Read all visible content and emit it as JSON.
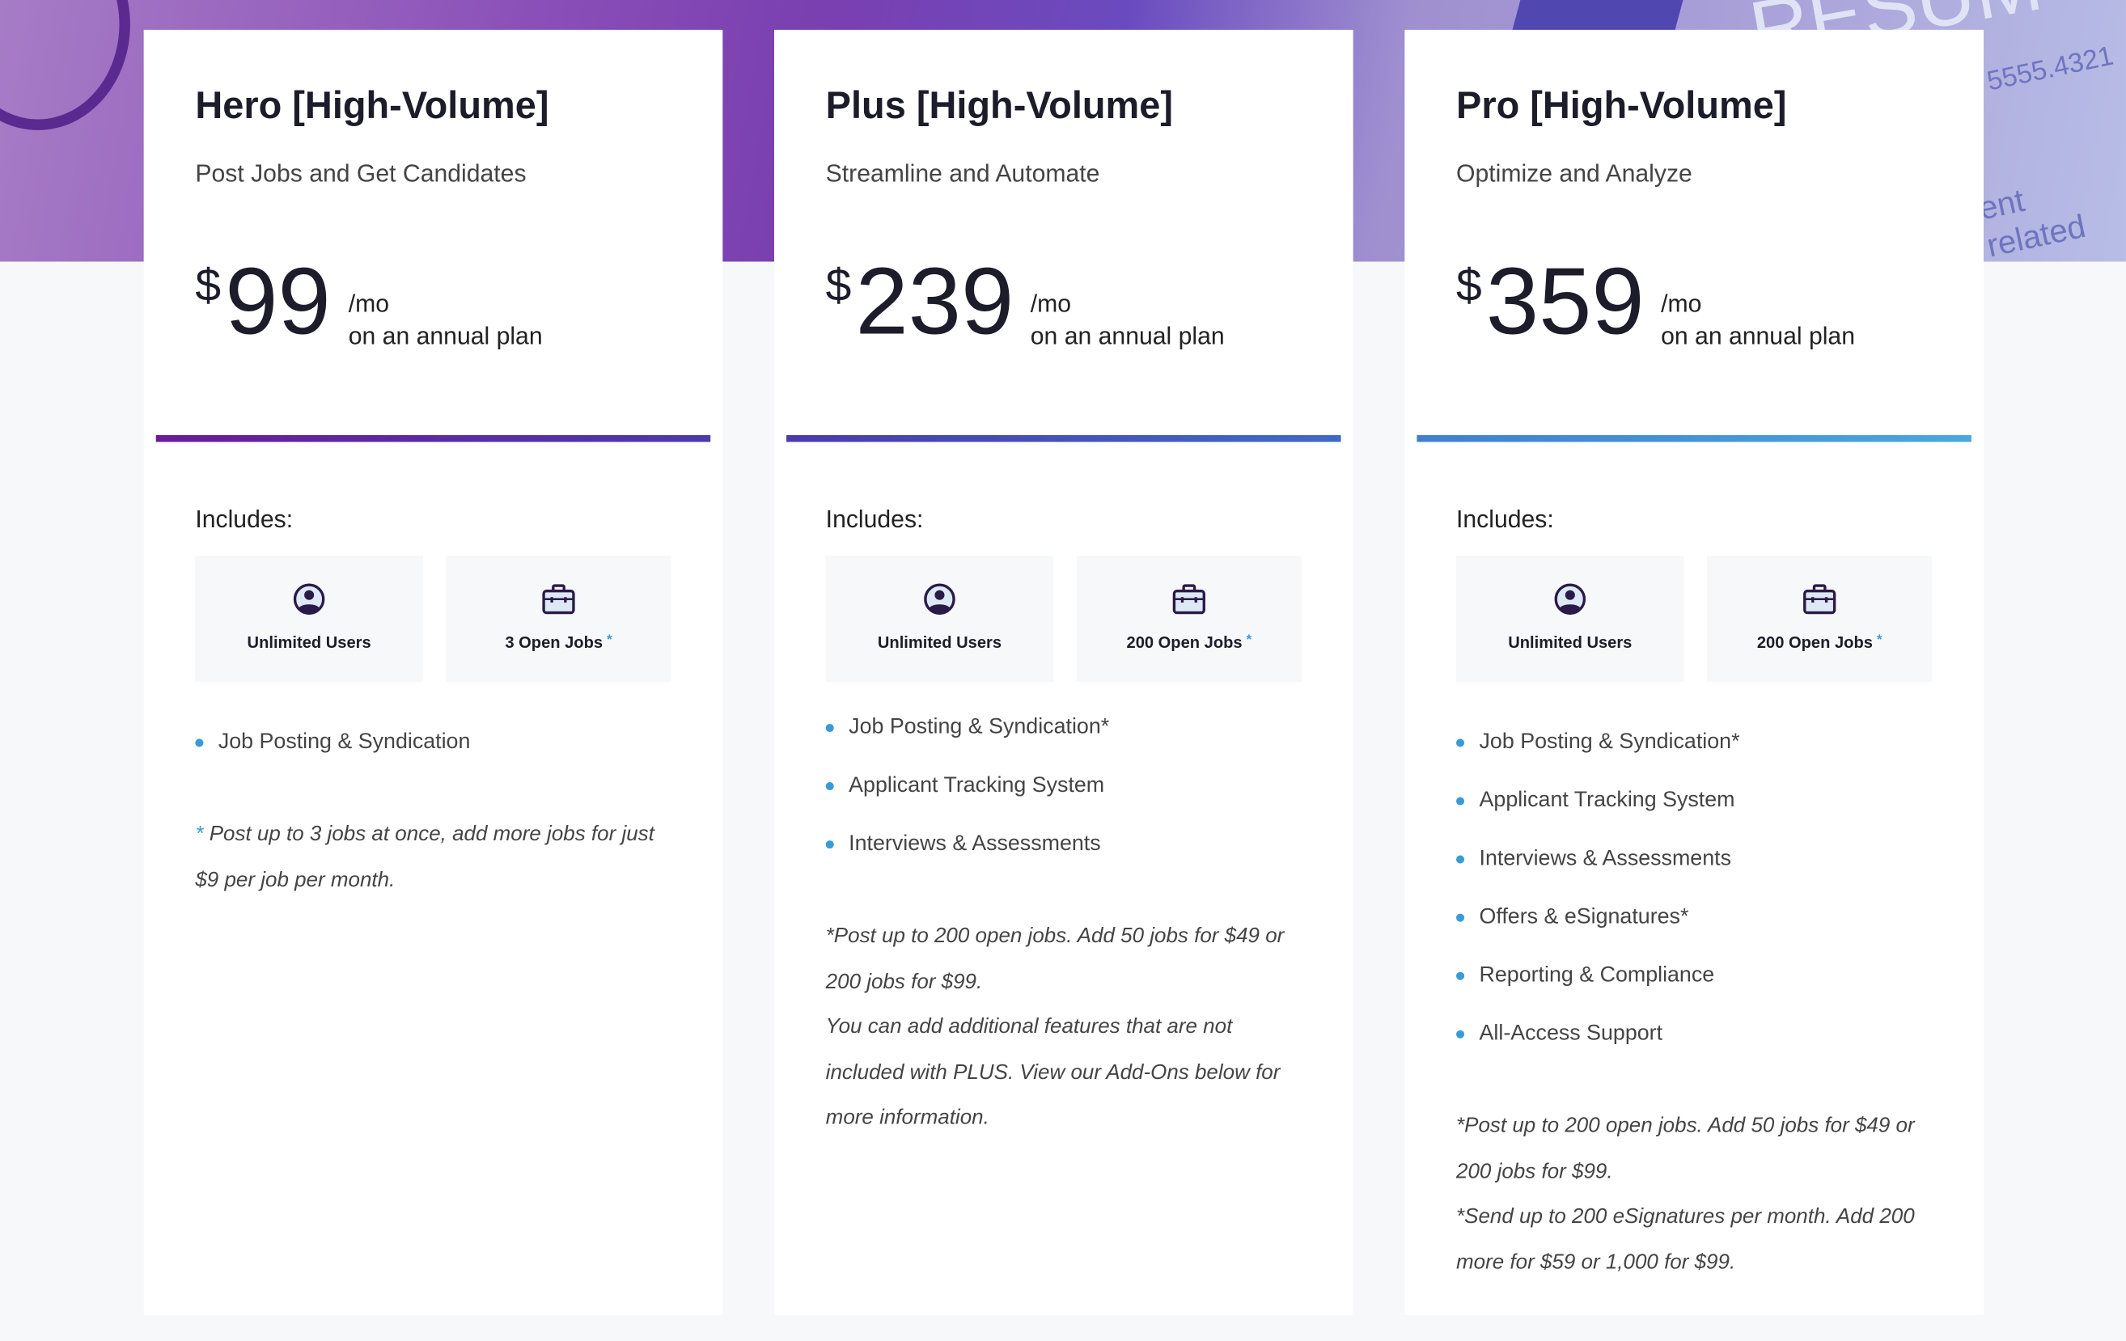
{
  "background_text": [
    "5555.4321",
    "ent related",
    "RESUM"
  ],
  "plans": [
    {
      "title": "Hero [High-Volume]",
      "subtitle": "Post Jobs and Get Candidates",
      "currency": "$",
      "price": "99",
      "per": "/mo",
      "term": "on an annual plan",
      "bar_colors": [
        "#6a1b9a",
        "#4a3aab"
      ],
      "includes": "Includes:",
      "boxes": [
        {
          "icon": "user-circle-icon",
          "label": "Unlimited Users",
          "asterisk": ""
        },
        {
          "icon": "briefcase-icon",
          "label": "3 Open Jobs",
          "asterisk": "*"
        }
      ],
      "features": [
        "Job Posting & Syndication"
      ],
      "notes": [
        {
          "asterisk": "*",
          "text": " Post up to 3 jobs at once, add more jobs for just $9 per job per month."
        }
      ]
    },
    {
      "title": "Plus [High-Volume]",
      "subtitle": "Streamline and Automate",
      "currency": "$",
      "price": "239",
      "per": "/mo",
      "term": "on an annual plan",
      "bar_colors": [
        "#4a3aab",
        "#3f6bc4"
      ],
      "includes": "Includes:",
      "boxes": [
        {
          "icon": "user-circle-icon",
          "label": "Unlimited Users",
          "asterisk": ""
        },
        {
          "icon": "briefcase-icon",
          "label": "200 Open Jobs",
          "asterisk": "*"
        }
      ],
      "features": [
        "Job Posting & Syndication*",
        "Applicant Tracking System",
        "Interviews & Assessments"
      ],
      "notes": [
        {
          "asterisk": "",
          "text": "*Post up to 200 open jobs. Add 50 jobs for $49 or 200 jobs for $99."
        },
        {
          "asterisk": "",
          "text": "You can add additional features that are not included with PLUS. View our Add-Ons below for more information."
        }
      ]
    },
    {
      "title": "Pro [High-Volume]",
      "subtitle": "Optimize and Analyze",
      "currency": "$",
      "price": "359",
      "per": "/mo",
      "term": "on an annual plan",
      "bar_colors": [
        "#3f7fd0",
        "#4aa8dc"
      ],
      "includes": "Includes:",
      "boxes": [
        {
          "icon": "user-circle-icon",
          "label": "Unlimited Users",
          "asterisk": ""
        },
        {
          "icon": "briefcase-icon",
          "label": "200 Open Jobs",
          "asterisk": "*"
        }
      ],
      "features": [
        "Job Posting & Syndication*",
        "Applicant Tracking System",
        "Interviews & Assessments",
        "Offers & eSignatures*",
        "Reporting & Compliance",
        "All-Access Support"
      ],
      "notes": [
        {
          "asterisk": "",
          "text": "*Post up to 200 open jobs. Add 50 jobs for $49 or 200 jobs for $99."
        },
        {
          "asterisk": "",
          "text": "*Send up to 200 eSignatures per month. Add 200 more for $59 or 1,000 for $99."
        }
      ]
    }
  ]
}
